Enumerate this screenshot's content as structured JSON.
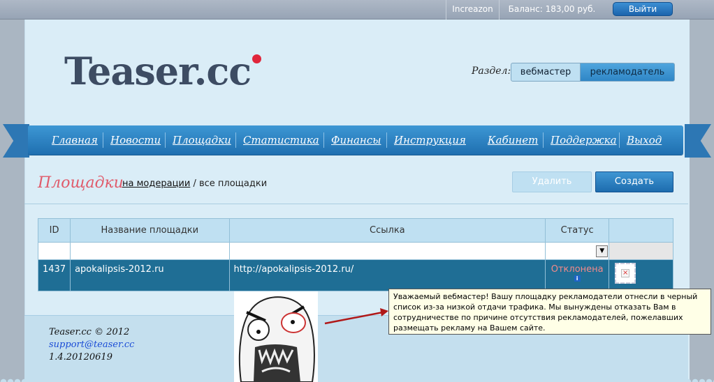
{
  "topbar": {
    "user": "Increazon",
    "balance": "Баланс: 183,00 руб.",
    "logout": "Выйти"
  },
  "logo": {
    "text": "Teaser.cc"
  },
  "section": {
    "label": "Раздел:",
    "options": [
      "вебмастер",
      "рекламодатель"
    ],
    "active": "рекламодатель"
  },
  "nav": [
    "Главная",
    "Новости",
    "Площадки",
    "Статистика",
    "Финансы",
    "Инструкция",
    "Кабинет",
    "Поддержка",
    "Выход"
  ],
  "page": {
    "title": "Площадки",
    "crumb_link": "на модерации",
    "crumb_rest": " / все площадки",
    "delete_button": "Удалить",
    "create_button": "Создать"
  },
  "table": {
    "headers": [
      "ID",
      "Название площадки",
      "Ссылка",
      "Статус",
      ""
    ],
    "rows": [
      {
        "id": "1437",
        "name": "apokalipsis-2012.ru",
        "url": "http://apokalipsis-2012.ru/",
        "status": "Отклонена"
      }
    ]
  },
  "tooltip": {
    "text": "Уважаемый вебмастер! Вашу площадку рекламодатели отнесли в черный список из-за низкой отдачи трафика. Мы вынуждены отказать Вам в сотрудничестве по причине отсутствия рекламодателей, пожелавших размещать рекламу на Вашем сайте."
  },
  "footer": {
    "copyright": "Teaser.cc © 2012",
    "email": "support@teaser.cc",
    "version": "1.4.20120619"
  },
  "colors": {
    "nav": "#2a80c1",
    "title": "#e05a6a",
    "row": "#1f6e95",
    "status_rejected": "#f38a8a"
  }
}
